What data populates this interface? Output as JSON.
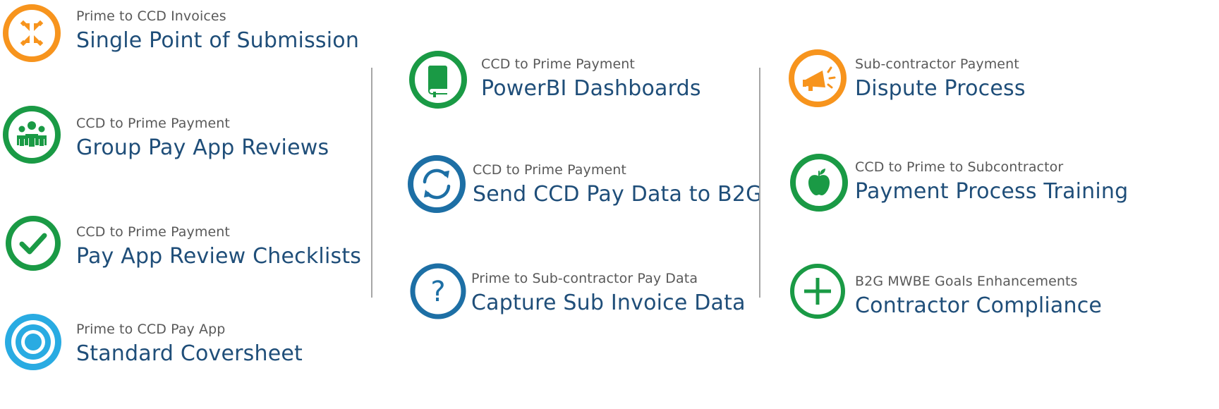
{
  "colors": {
    "orange": "#F7941D",
    "green": "#1A9A45",
    "dark_green": "#178A3E",
    "blue": "#1D6FA5",
    "light_blue": "#29ABE2",
    "subtitle_text": "#595959",
    "title_text": "#1F4E79"
  },
  "items": [
    {
      "subtitle": "Prime to CCD Invoices",
      "title": "Single Point of Submission",
      "icon": "arrows-inward-icon",
      "color": "orange"
    },
    {
      "subtitle": "CCD to Prime Payment",
      "title": "Group Pay App Reviews",
      "icon": "people-group-icon",
      "color": "green"
    },
    {
      "subtitle": "CCD to Prime Payment",
      "title": "Pay App Review Checklists",
      "icon": "checkmark-icon",
      "color": "green"
    },
    {
      "subtitle": "Prime to CCD Pay App",
      "title": "Standard Coversheet",
      "icon": "target-icon",
      "color": "light_blue"
    },
    {
      "subtitle": "CCD to Prime Payment",
      "title": "PowerBI Dashboards",
      "icon": "book-icon",
      "color": "green"
    },
    {
      "subtitle": "CCD to Prime Payment",
      "title": "Send CCD Pay Data to B2G",
      "icon": "sync-icon",
      "color": "blue"
    },
    {
      "subtitle": "Prime to Sub-contractor Pay Data",
      "title": "Capture Sub Invoice Data",
      "icon": "question-icon",
      "color": "blue"
    },
    {
      "subtitle": "Sub-contractor Payment",
      "title": "Dispute Process",
      "icon": "megaphone-icon",
      "color": "orange"
    },
    {
      "subtitle": "CCD to Prime to Subcontractor",
      "title": "Payment Process Training",
      "icon": "apple-icon",
      "color": "green"
    },
    {
      "subtitle": "B2G MWBE Goals Enhancements",
      "title": "Contractor Compliance",
      "icon": "plus-icon",
      "color": "green"
    }
  ]
}
